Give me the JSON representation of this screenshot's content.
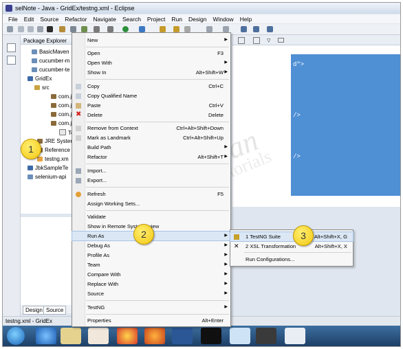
{
  "window": {
    "title": "selNote - Java - GridEx/testng.xml - Eclipse"
  },
  "menubar": [
    "File",
    "Edit",
    "Source",
    "Refactor",
    "Navigate",
    "Search",
    "Project",
    "Run",
    "Design",
    "Window",
    "Help"
  ],
  "package_explorer": {
    "title": "Package Explorer",
    "items": [
      "BasicMaven",
      "cucumber-m",
      "cucumber-te",
      "GridEx",
      "src",
      "com.j",
      "com.j",
      "com.j",
      "com.j",
      "Te",
      "JRE Syster",
      "Reference",
      "testng.xm",
      "JbkSampleTe",
      "selenium-api"
    ]
  },
  "bottom_tabs": [
    "Design",
    "Source"
  ],
  "status": "testng.xml - GridEx",
  "editor_fragments": [
    "d\">",
    "/>",
    "/>"
  ],
  "context_menu": [
    {
      "label": "New",
      "shortcut": "",
      "arrow": true
    },
    {
      "label": "Open",
      "shortcut": "F3"
    },
    {
      "label": "Open With",
      "shortcut": "",
      "arrow": true
    },
    {
      "label": "Show In",
      "shortcut": "Alt+Shift+W",
      "arrow": true
    },
    {
      "label": "Copy",
      "shortcut": "Ctrl+C"
    },
    {
      "label": "Copy Qualified Name",
      "shortcut": ""
    },
    {
      "label": "Paste",
      "shortcut": "Ctrl+V"
    },
    {
      "label": "Delete",
      "shortcut": "Delete"
    },
    {
      "label": "Remove from Context",
      "shortcut": "Ctrl+Alt+Shift+Down"
    },
    {
      "label": "Mark as Landmark",
      "shortcut": "Ctrl+Alt+Shift+Up"
    },
    {
      "label": "Build Path",
      "shortcut": "",
      "arrow": true
    },
    {
      "label": "Refactor",
      "shortcut": "Alt+Shift+T",
      "arrow": true
    },
    {
      "label": "Import...",
      "shortcut": ""
    },
    {
      "label": "Export...",
      "shortcut": ""
    },
    {
      "label": "Refresh",
      "shortcut": "F5"
    },
    {
      "label": "Assign Working Sets...",
      "shortcut": ""
    },
    {
      "label": "Validate",
      "shortcut": ""
    },
    {
      "label": "Show in Remote Systems view",
      "shortcut": ""
    },
    {
      "label": "Run As",
      "shortcut": "",
      "arrow": true
    },
    {
      "label": "Debug As",
      "shortcut": "",
      "arrow": true
    },
    {
      "label": "Profile As",
      "shortcut": "",
      "arrow": true
    },
    {
      "label": "Team",
      "shortcut": "",
      "arrow": true
    },
    {
      "label": "Compare With",
      "shortcut": "",
      "arrow": true
    },
    {
      "label": "Replace With",
      "shortcut": "",
      "arrow": true
    },
    {
      "label": "Source",
      "shortcut": "",
      "arrow": true
    },
    {
      "label": "TestNG",
      "shortcut": "",
      "arrow": true
    },
    {
      "label": "Properties",
      "shortcut": "Alt+Enter"
    }
  ],
  "submenu": [
    {
      "label": "1 TestNG Suite",
      "shortcut": "Alt+Shift+X, G"
    },
    {
      "label": "2 XSL Transformation",
      "shortcut": "Alt+Shift+X, X"
    },
    {
      "label": "Run Configurations...",
      "shortcut": ""
    }
  ],
  "callouts": [
    "1",
    "2",
    "3"
  ],
  "watermark": [
    "JavabyKiran",
    "Tutorials"
  ],
  "colors": {
    "editor_blue": "#4f8fd4",
    "callout_yellow": "#f3c712",
    "highlight": "#dbe7f5"
  }
}
